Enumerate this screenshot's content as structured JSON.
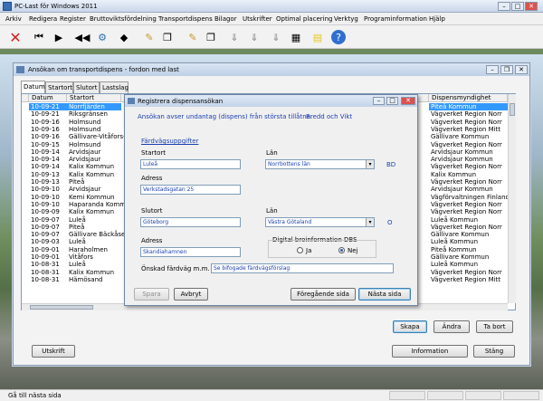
{
  "window": {
    "title": "PC-Last för Windows 2011"
  },
  "menu": [
    "Arkiv",
    "Redigera",
    "Register",
    "Bruttoviktsfördelning",
    "Transportdispens",
    "Bilagor",
    "Utskrifter",
    "Optimal placering",
    "Verktyg",
    "Programinformation",
    "Hjälp"
  ],
  "main": {
    "title": "Ansökan om transportdispens - fordon med last",
    "tabs": [
      "Datum",
      "Startort",
      "Slutort",
      "Lastslag"
    ],
    "columns": {
      "datum": "Datum",
      "startort": "Startort",
      "myndighet": "Dispensmyndighet"
    },
    "rows": [
      [
        "10-09-21",
        "Norrfjärden",
        "Piteå Kommun"
      ],
      [
        "10-09-21",
        "Riksgränsen",
        "Vägverket Region Norr"
      ],
      [
        "10-09-16",
        "Holmsund",
        "Vägverket Region Norr"
      ],
      [
        "10-09-16",
        "Holmsund",
        "Vägverket Region Mitt"
      ],
      [
        "10-09-16",
        "Gällivare-Vitåfors-v",
        "Gällivare Kommun"
      ],
      [
        "10-09-15",
        "Holmsund",
        "Vägverket Region Norr"
      ],
      [
        "10-09-14",
        "Arvidsjaur",
        "Arvidsjaur Kommun"
      ],
      [
        "10-09-14",
        "Arvidsjaur",
        "Arvidsjaur Kommun"
      ],
      [
        "10-09-14",
        "Kalix Kommun",
        "Vägverket Region Norr"
      ],
      [
        "10-09-13",
        "Kalix Kommun",
        "Kalix Kommun"
      ],
      [
        "10-09-13",
        "Piteå",
        "Vägverket Region Norr"
      ],
      [
        "10-09-10",
        "Arvidsjaur",
        "Arvidsjaur Kommun"
      ],
      [
        "10-09-10",
        "Kemi Kommun",
        "Vägförvaltningen Finland"
      ],
      [
        "10-09-10",
        "Haparanda Kommun",
        "Vägverket Region Norr"
      ],
      [
        "10-09-09",
        "Kalix Kommun",
        "Vägverket Region Norr"
      ],
      [
        "10-09-07",
        "Luleå",
        "Luleå Kommun"
      ],
      [
        "10-09-07",
        "Piteå",
        "Vägverket Region Norr"
      ],
      [
        "10-09-07",
        "Gällivare Bäckåse",
        "Gällivare Kommun"
      ],
      [
        "10-09-03",
        "Luleå",
        "Luleå Kommun"
      ],
      [
        "10-09-01",
        "Haraholmen",
        "Piteå Kommun"
      ],
      [
        "10-09-01",
        "Vitåfors",
        "Gällivare Kommun"
      ],
      [
        "10-08-31",
        "Luleå",
        "Luleå Kommun"
      ],
      [
        "10-08-31",
        "Kalix Kommun",
        "Vägverket Region Norr"
      ],
      [
        "10-08-31",
        "Hämösand",
        "Vägverket Region Mitt"
      ]
    ],
    "buttons": {
      "skapa": "Skapa",
      "andra": "Ändra",
      "tabort": "Ta bort",
      "utskrift": "Utskrift",
      "information": "Information",
      "stang": "Stäng"
    }
  },
  "dialog": {
    "title": "Registrera dispensansökan",
    "subtitle": "Ansökan avser undantag (dispens) från största tillåtna:",
    "subtitle_value": "Bredd och Vikt",
    "section": "Färdvägsuppgifter",
    "startort_label": "Startort",
    "startort": "Luleå",
    "lan_label": "Län",
    "lan1": "Norrbottens län",
    "lan1_code": "BD",
    "adress_label": "Adress",
    "adress1": "Verkstadsgatan 25",
    "slutort_label": "Slutort",
    "slutort": "Göteborg",
    "lan2": "Västra Götaland",
    "lan2_code": "O",
    "adress2": "Skandiahamnen",
    "dbs_label": "Digital broinformation DBS",
    "ja": "Ja",
    "nej": "Nej",
    "fardvag_label": "Önskad färdväg m.m.",
    "fardvag": "Se bifogade färdvägsförslag",
    "buttons": {
      "spara": "Spara",
      "avbryt": "Avbryt",
      "foregaende": "Föregående sida",
      "nasta": "Nästa sida"
    }
  },
  "status": "Gå till nästa sida",
  "colors": {
    "selection": "#3399ff",
    "link": "#1a3fb0"
  }
}
